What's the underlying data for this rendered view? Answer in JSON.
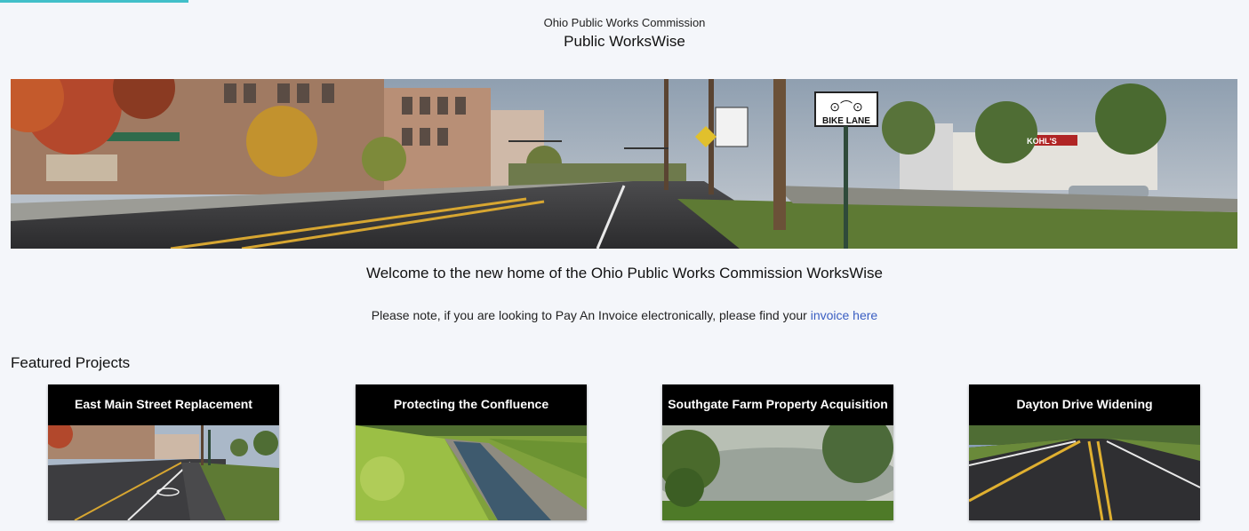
{
  "header": {
    "organization": "Ohio Public Works Commission",
    "app_title": "Public WorksWise"
  },
  "hero": {
    "sign_text": "BIKE LANE",
    "store_text": "KOHL'S"
  },
  "welcome": {
    "text": "Welcome to the new home of the Ohio Public Works Commission WorksWise"
  },
  "notice": {
    "prefix": "Please note, if you are looking to Pay An Invoice electronically, please find your ",
    "link_text": "invoice here"
  },
  "featured": {
    "title": "Featured Projects",
    "projects": [
      {
        "title": "East Main Street Replacement"
      },
      {
        "title": "Protecting the Confluence"
      },
      {
        "title": "Southgate Farm Property Acquisition"
      },
      {
        "title": "Dayton Drive Widening"
      }
    ]
  },
  "colors": {
    "accent": "#41bfc9",
    "link": "#3a5ec2",
    "background": "#f4f6fa",
    "card_header": "#000000"
  }
}
